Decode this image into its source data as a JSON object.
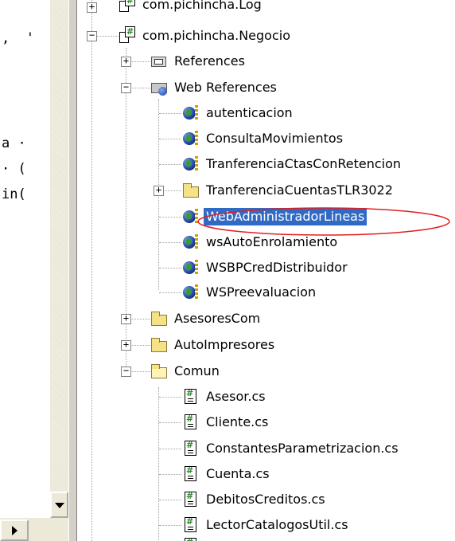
{
  "editor": {
    "code_fragments": [
      ",  '",
      "a ·",
      "· (",
      "in("
    ]
  },
  "tree": {
    "items": [
      {
        "label": "com.pichincha.Log",
        "icon": "project-icon",
        "expander": "+"
      },
      {
        "label": "com.pichincha.Negocio",
        "icon": "project-icon",
        "expander": "−"
      },
      {
        "label": "References",
        "icon": "references-icon",
        "expander": "+"
      },
      {
        "label": "Web References",
        "icon": "web-references-icon",
        "expander": "−"
      },
      {
        "label": "autenticacion",
        "icon": "web-service-icon"
      },
      {
        "label": "ConsultaMovimientos",
        "icon": "web-service-icon"
      },
      {
        "label": "TranferenciaCtasConRetencion",
        "icon": "web-service-icon"
      },
      {
        "label": "TranferenciaCuentasTLR3022",
        "icon": "folder-icon",
        "expander": "+"
      },
      {
        "label": "WebAdministradorLineas",
        "icon": "web-service-icon",
        "selected": true
      },
      {
        "label": "wsAutoEnrolamiento",
        "icon": "web-service-icon"
      },
      {
        "label": "WSBPCredDistribuidor",
        "icon": "web-service-icon"
      },
      {
        "label": "WSPreevaluacion",
        "icon": "web-service-icon"
      },
      {
        "label": "AsesoresCom",
        "icon": "folder-icon",
        "expander": "+"
      },
      {
        "label": "AutoImpresores",
        "icon": "folder-icon",
        "expander": "+"
      },
      {
        "label": "Comun",
        "icon": "open-folder-icon",
        "expander": "−"
      },
      {
        "label": "Asesor.cs",
        "icon": "cs-file-icon"
      },
      {
        "label": "Cliente.cs",
        "icon": "cs-file-icon"
      },
      {
        "label": "ConstantesParametrizacion.cs",
        "icon": "cs-file-icon"
      },
      {
        "label": "Cuenta.cs",
        "icon": "cs-file-icon"
      },
      {
        "label": "DebitosCreditos.cs",
        "icon": "cs-file-icon"
      },
      {
        "label": "LectorCatalogosUtil.cs",
        "icon": "cs-file-icon"
      }
    ]
  },
  "annotation": {
    "color": "#e02020",
    "target": "WebAdministradorLineas"
  },
  "colors": {
    "selection": "#316ac5",
    "panel": "#ece9d8"
  }
}
